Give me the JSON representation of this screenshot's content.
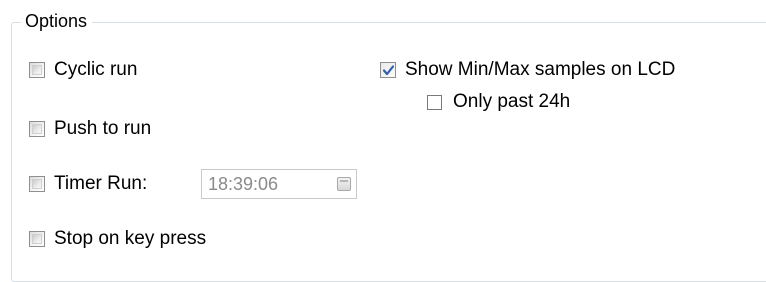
{
  "options_group": {
    "title": "Options"
  },
  "checkboxes": {
    "cyclic_run": {
      "label": "Cyclic run",
      "checked": false
    },
    "push_to_run": {
      "label": "Push to run",
      "checked": false
    },
    "timer_run": {
      "label": "Timer Run:",
      "checked": false
    },
    "stop_on_key_press": {
      "label": "Stop on key press",
      "checked": false
    },
    "show_min_max": {
      "label": "Show Min/Max samples on LCD",
      "checked": true
    },
    "only_past_24h": {
      "label": "Only past 24h",
      "checked": false
    }
  },
  "timer_input": {
    "value": "18:39:06",
    "icon": "calendar-icon"
  },
  "colors": {
    "groupbox_border": "#d5dfe5",
    "checkmark": "#2f5fa8",
    "disabled_text": "#8a8a8a"
  }
}
